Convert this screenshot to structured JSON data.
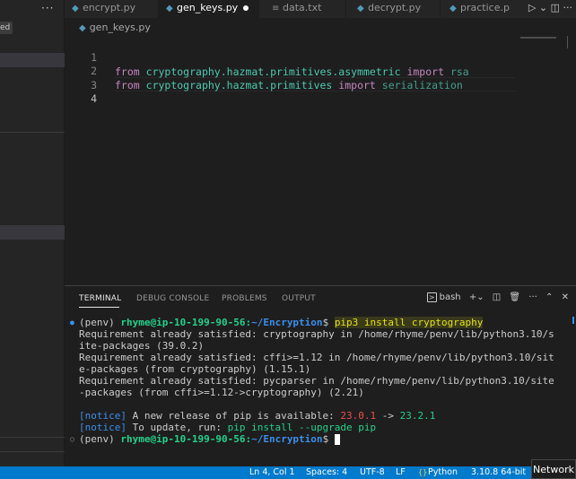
{
  "sidebar": {
    "more": "···",
    "badge": "ed"
  },
  "tabs": [
    {
      "label": "encrypt.py",
      "icon": "python-file-icon",
      "active": false
    },
    {
      "label": "gen_keys.py",
      "icon": "python-file-icon",
      "active": true,
      "dirty": true
    },
    {
      "label": "data.txt",
      "icon": "text-file-icon",
      "active": false
    },
    {
      "label": "decrypt.py",
      "icon": "python-file-icon",
      "active": false
    },
    {
      "label": "practice.p",
      "icon": "python-file-icon",
      "active": false
    }
  ],
  "breadcrumb": {
    "file": "gen_keys.py"
  },
  "editor": {
    "lines": [
      {
        "num": "1",
        "kw1": "from",
        "module": "cryptography.hazmat.primitives.asymmetric",
        "kw2": "import",
        "ident": "rsa"
      },
      {
        "num": "2",
        "kw1": "from",
        "module": "cryptography.hazmat.primitives",
        "kw2": "import",
        "ident": "serialization"
      },
      {
        "num": "3"
      },
      {
        "num": "4"
      }
    ]
  },
  "panel": {
    "tabs": {
      "terminal": "TERMINAL",
      "debug_console": "DEBUG CONSOLE",
      "problems": "PROBLEMS",
      "output": "OUTPUT"
    },
    "shell_label": "bash"
  },
  "terminal": {
    "prompt_env": "(penv)",
    "prompt_user": "rhyme@ip-10-199-90-56",
    "prompt_sep": ":",
    "prompt_path": "~/Encryption",
    "prompt_dollar": "$",
    "command": "pip3 install cryptography",
    "out1a": "Requirement already satisfied: cryptography in /home/rhyme/penv/lib/python3.10/s",
    "out1b": "ite-packages (39.0.2)",
    "out2a": "Requirement already satisfied: cffi>=1.12 in /home/rhyme/penv/lib/python3.10/sit",
    "out2b": "e-packages (from cryptography) (1.15.1)",
    "out3a": "Requirement already satisfied: pycparser in /home/rhyme/penv/lib/python3.10/site",
    "out3b": "-packages (from cffi>=1.12->cryptography) (2.21)",
    "notice_tag": "[notice]",
    "notice1_text": "A new release of pip is available:",
    "notice1_old": "23.0.1",
    "notice1_arrow": "->",
    "notice1_new": "23.2.1",
    "notice2_text": "To update, run:",
    "notice2_cmd": "pip install --upgrade pip"
  },
  "status": {
    "position": "Ln 4, Col 1",
    "spaces": "Spaces: 4",
    "encoding": "UTF-8",
    "eol": "LF",
    "language": "Python",
    "interpreter": "3.10.8 64-bit"
  },
  "network": "Network",
  "colors": {
    "statusbar": "#007acc",
    "editor_bg": "#1e1e1e",
    "sidebar_bg": "#252526"
  }
}
